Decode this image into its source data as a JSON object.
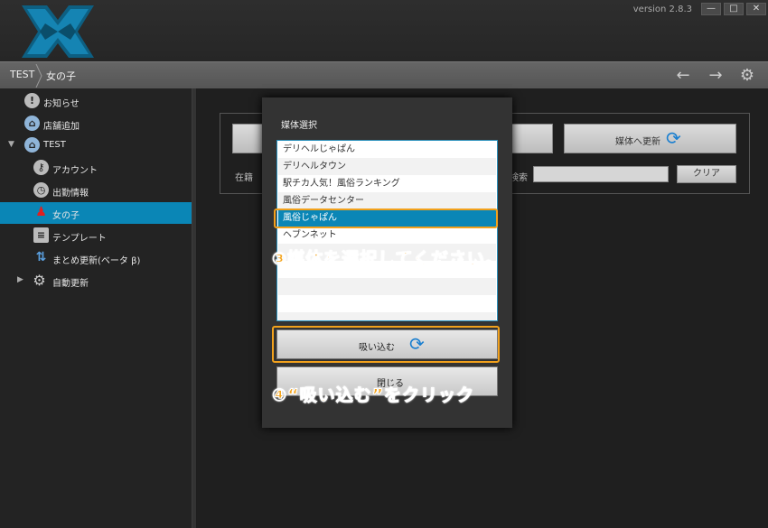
{
  "window": {
    "version": "version 2.8.3",
    "min_label": "—",
    "max_label": "□",
    "close_label": "✕"
  },
  "breadcrumb": {
    "root": "TEST",
    "current": "女の子"
  },
  "sidebar": {
    "items": [
      {
        "label": "お知らせ",
        "icon": "info-icon"
      },
      {
        "label": "店舗追加",
        "icon": "home-add-icon"
      },
      {
        "label": "TEST",
        "icon": "home-icon"
      },
      {
        "label": "アカウント",
        "icon": "key-icon"
      },
      {
        "label": "出勤情報",
        "icon": "clock-icon"
      },
      {
        "label": "女の子",
        "icon": "person-icon"
      },
      {
        "label": "テンプレート",
        "icon": "document-icon"
      },
      {
        "label": "まとめ更新(ベータ β)",
        "icon": "upload-icon"
      },
      {
        "label": "自動更新",
        "icon": "gear-icon"
      }
    ]
  },
  "main": {
    "update_media_button": "媒体へ更新",
    "zaiseki_label": "在籍",
    "search_label": "検索",
    "clear_button": "クリア"
  },
  "dialog": {
    "title": "媒体選択",
    "media": [
      "デリヘルじゃぱん",
      "デリヘルタウン",
      "駅チカ人気！風俗ランキング",
      "風俗データセンター",
      "風俗じゃぱん",
      "ヘブンネット"
    ],
    "selected_index": 4,
    "import_button": "吸い込む",
    "close_button": "閉じる"
  },
  "annotations": {
    "step3": "③媒体を選択してください。",
    "step4": "④“吸い込む”をクリック"
  },
  "colors": {
    "accent": "#0a86b6",
    "highlight": "#f2a11c"
  }
}
